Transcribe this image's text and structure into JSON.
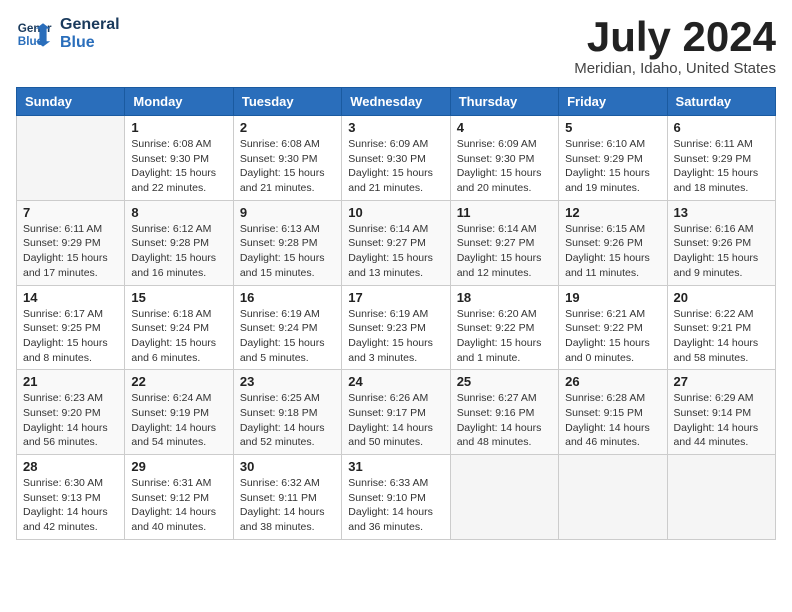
{
  "logo": {
    "line1": "General",
    "line2": "Blue"
  },
  "title": "July 2024",
  "subtitle": "Meridian, Idaho, United States",
  "header_days": [
    "Sunday",
    "Monday",
    "Tuesday",
    "Wednesday",
    "Thursday",
    "Friday",
    "Saturday"
  ],
  "weeks": [
    [
      {
        "day": "",
        "sunrise": "",
        "sunset": "",
        "daylight": ""
      },
      {
        "day": "1",
        "sunrise": "Sunrise: 6:08 AM",
        "sunset": "Sunset: 9:30 PM",
        "daylight": "Daylight: 15 hours and 22 minutes."
      },
      {
        "day": "2",
        "sunrise": "Sunrise: 6:08 AM",
        "sunset": "Sunset: 9:30 PM",
        "daylight": "Daylight: 15 hours and 21 minutes."
      },
      {
        "day": "3",
        "sunrise": "Sunrise: 6:09 AM",
        "sunset": "Sunset: 9:30 PM",
        "daylight": "Daylight: 15 hours and 21 minutes."
      },
      {
        "day": "4",
        "sunrise": "Sunrise: 6:09 AM",
        "sunset": "Sunset: 9:30 PM",
        "daylight": "Daylight: 15 hours and 20 minutes."
      },
      {
        "day": "5",
        "sunrise": "Sunrise: 6:10 AM",
        "sunset": "Sunset: 9:29 PM",
        "daylight": "Daylight: 15 hours and 19 minutes."
      },
      {
        "day": "6",
        "sunrise": "Sunrise: 6:11 AM",
        "sunset": "Sunset: 9:29 PM",
        "daylight": "Daylight: 15 hours and 18 minutes."
      }
    ],
    [
      {
        "day": "7",
        "sunrise": "Sunrise: 6:11 AM",
        "sunset": "Sunset: 9:29 PM",
        "daylight": "Daylight: 15 hours and 17 minutes."
      },
      {
        "day": "8",
        "sunrise": "Sunrise: 6:12 AM",
        "sunset": "Sunset: 9:28 PM",
        "daylight": "Daylight: 15 hours and 16 minutes."
      },
      {
        "day": "9",
        "sunrise": "Sunrise: 6:13 AM",
        "sunset": "Sunset: 9:28 PM",
        "daylight": "Daylight: 15 hours and 15 minutes."
      },
      {
        "day": "10",
        "sunrise": "Sunrise: 6:14 AM",
        "sunset": "Sunset: 9:27 PM",
        "daylight": "Daylight: 15 hours and 13 minutes."
      },
      {
        "day": "11",
        "sunrise": "Sunrise: 6:14 AM",
        "sunset": "Sunset: 9:27 PM",
        "daylight": "Daylight: 15 hours and 12 minutes."
      },
      {
        "day": "12",
        "sunrise": "Sunrise: 6:15 AM",
        "sunset": "Sunset: 9:26 PM",
        "daylight": "Daylight: 15 hours and 11 minutes."
      },
      {
        "day": "13",
        "sunrise": "Sunrise: 6:16 AM",
        "sunset": "Sunset: 9:26 PM",
        "daylight": "Daylight: 15 hours and 9 minutes."
      }
    ],
    [
      {
        "day": "14",
        "sunrise": "Sunrise: 6:17 AM",
        "sunset": "Sunset: 9:25 PM",
        "daylight": "Daylight: 15 hours and 8 minutes."
      },
      {
        "day": "15",
        "sunrise": "Sunrise: 6:18 AM",
        "sunset": "Sunset: 9:24 PM",
        "daylight": "Daylight: 15 hours and 6 minutes."
      },
      {
        "day": "16",
        "sunrise": "Sunrise: 6:19 AM",
        "sunset": "Sunset: 9:24 PM",
        "daylight": "Daylight: 15 hours and 5 minutes."
      },
      {
        "day": "17",
        "sunrise": "Sunrise: 6:19 AM",
        "sunset": "Sunset: 9:23 PM",
        "daylight": "Daylight: 15 hours and 3 minutes."
      },
      {
        "day": "18",
        "sunrise": "Sunrise: 6:20 AM",
        "sunset": "Sunset: 9:22 PM",
        "daylight": "Daylight: 15 hours and 1 minute."
      },
      {
        "day": "19",
        "sunrise": "Sunrise: 6:21 AM",
        "sunset": "Sunset: 9:22 PM",
        "daylight": "Daylight: 15 hours and 0 minutes."
      },
      {
        "day": "20",
        "sunrise": "Sunrise: 6:22 AM",
        "sunset": "Sunset: 9:21 PM",
        "daylight": "Daylight: 14 hours and 58 minutes."
      }
    ],
    [
      {
        "day": "21",
        "sunrise": "Sunrise: 6:23 AM",
        "sunset": "Sunset: 9:20 PM",
        "daylight": "Daylight: 14 hours and 56 minutes."
      },
      {
        "day": "22",
        "sunrise": "Sunrise: 6:24 AM",
        "sunset": "Sunset: 9:19 PM",
        "daylight": "Daylight: 14 hours and 54 minutes."
      },
      {
        "day": "23",
        "sunrise": "Sunrise: 6:25 AM",
        "sunset": "Sunset: 9:18 PM",
        "daylight": "Daylight: 14 hours and 52 minutes."
      },
      {
        "day": "24",
        "sunrise": "Sunrise: 6:26 AM",
        "sunset": "Sunset: 9:17 PM",
        "daylight": "Daylight: 14 hours and 50 minutes."
      },
      {
        "day": "25",
        "sunrise": "Sunrise: 6:27 AM",
        "sunset": "Sunset: 9:16 PM",
        "daylight": "Daylight: 14 hours and 48 minutes."
      },
      {
        "day": "26",
        "sunrise": "Sunrise: 6:28 AM",
        "sunset": "Sunset: 9:15 PM",
        "daylight": "Daylight: 14 hours and 46 minutes."
      },
      {
        "day": "27",
        "sunrise": "Sunrise: 6:29 AM",
        "sunset": "Sunset: 9:14 PM",
        "daylight": "Daylight: 14 hours and 44 minutes."
      }
    ],
    [
      {
        "day": "28",
        "sunrise": "Sunrise: 6:30 AM",
        "sunset": "Sunset: 9:13 PM",
        "daylight": "Daylight: 14 hours and 42 minutes."
      },
      {
        "day": "29",
        "sunrise": "Sunrise: 6:31 AM",
        "sunset": "Sunset: 9:12 PM",
        "daylight": "Daylight: 14 hours and 40 minutes."
      },
      {
        "day": "30",
        "sunrise": "Sunrise: 6:32 AM",
        "sunset": "Sunset: 9:11 PM",
        "daylight": "Daylight: 14 hours and 38 minutes."
      },
      {
        "day": "31",
        "sunrise": "Sunrise: 6:33 AM",
        "sunset": "Sunset: 9:10 PM",
        "daylight": "Daylight: 14 hours and 36 minutes."
      },
      {
        "day": "",
        "sunrise": "",
        "sunset": "",
        "daylight": ""
      },
      {
        "day": "",
        "sunrise": "",
        "sunset": "",
        "daylight": ""
      },
      {
        "day": "",
        "sunrise": "",
        "sunset": "",
        "daylight": ""
      }
    ]
  ]
}
